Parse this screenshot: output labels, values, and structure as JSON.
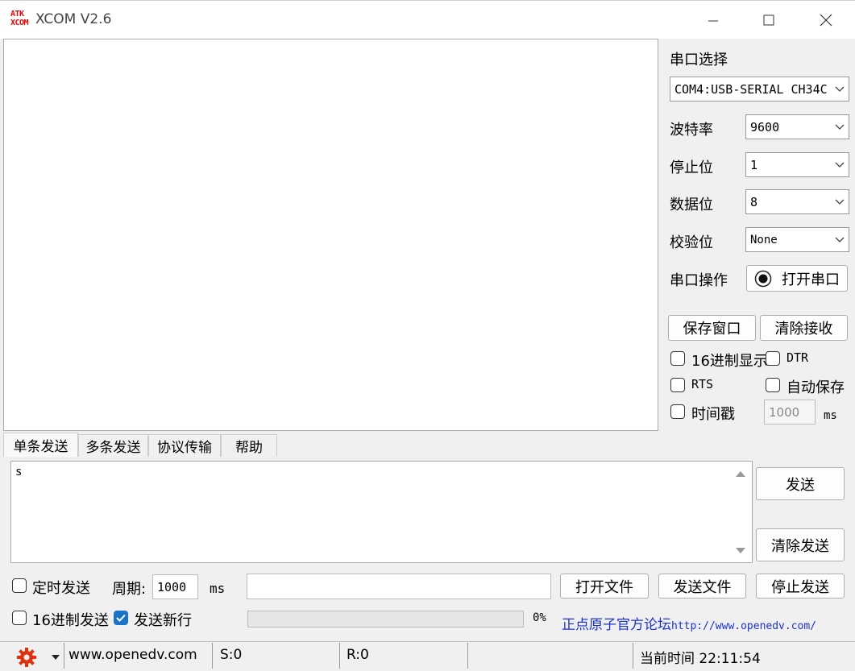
{
  "window": {
    "title": "XCOM V2.6",
    "logo_line1": "ATK",
    "logo_line2": "XCOM"
  },
  "serial": {
    "section_label": "串口选择",
    "port_value": "COM4:USB-SERIAL CH34C",
    "baud_label": "波特率",
    "baud_value": "9600",
    "stop_label": "停止位",
    "stop_value": "1",
    "data_label": "数据位",
    "data_value": "8",
    "parity_label": "校验位",
    "parity_value": "None",
    "op_label": "串口操作",
    "open_port_button": "打开串口"
  },
  "receive": {
    "save_window_button": "保存窗口",
    "clear_receive_button": "清除接收",
    "hex_display_label": "16进制显示",
    "dtr_label": "DTR",
    "rts_label": "RTS",
    "auto_save_label": "自动保存",
    "timestamp_label": "时间戳",
    "timestamp_value": "1000",
    "timestamp_unit": "ms"
  },
  "tabs": [
    {
      "label": "单条发送"
    },
    {
      "label": "多条发送"
    },
    {
      "label": "协议传输"
    },
    {
      "label": "帮助"
    }
  ],
  "send": {
    "text": "s",
    "send_button": "发送",
    "clear_send_button": "清除发送",
    "timed_send_label": "定时发送",
    "period_label": "周期:",
    "period_value": "1000",
    "period_unit": "ms",
    "open_file_button": "打开文件",
    "send_file_button": "发送文件",
    "stop_send_button": "停止发送",
    "hex_send_label": "16进制发送",
    "send_newline_label": "发送新行",
    "progress_text": "0%",
    "progress_value": 0,
    "forum_text": "正点原子官方论坛",
    "forum_url": "http://www.openedv.com/"
  },
  "status": {
    "website": "www.openedv.com",
    "sent": "S:0",
    "received": "R:0",
    "time_text": "当前时间 22:11:54"
  },
  "colors": {
    "accent": "#1a73c8",
    "logo": "#ee0000",
    "link": "#1a33cc",
    "gear": "#e03010"
  }
}
